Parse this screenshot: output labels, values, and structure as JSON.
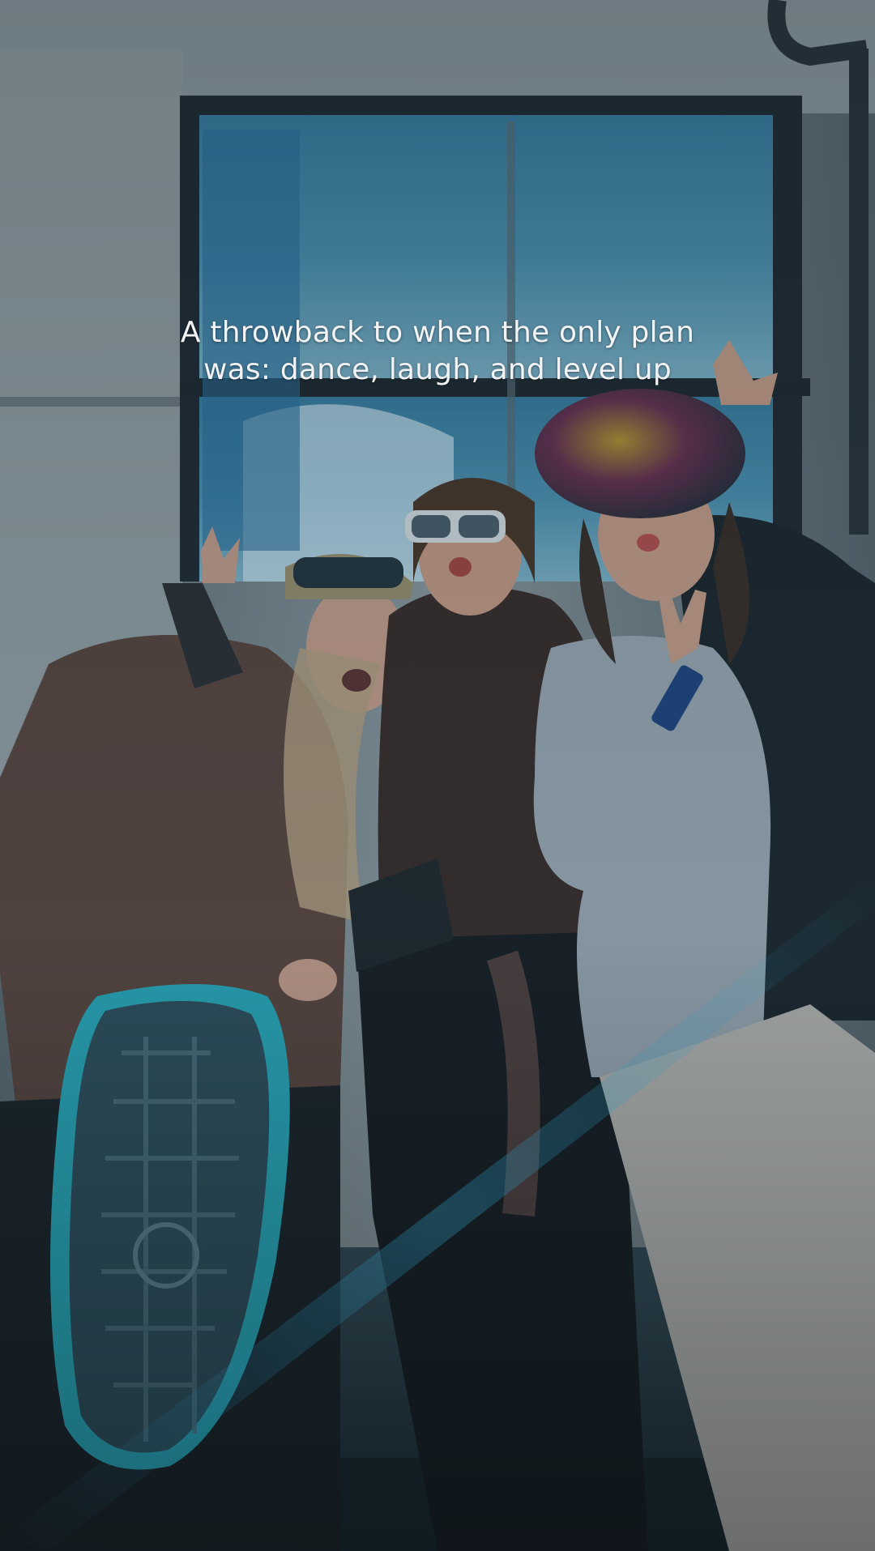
{
  "caption": {
    "line1": "A throwback to when the only plan",
    "line2": "was: dance, laugh, and level up"
  },
  "colors": {
    "window_glass": "#3f7fa0",
    "window_frame": "#20262d",
    "cabin_wall": "#8b9296",
    "fur_coat": "#5a4038",
    "hoodie": "#9ba4ad",
    "boot_sole": "#2f4a56",
    "boot_accent": "#2aa7b7",
    "floor": "#2b3a42"
  }
}
